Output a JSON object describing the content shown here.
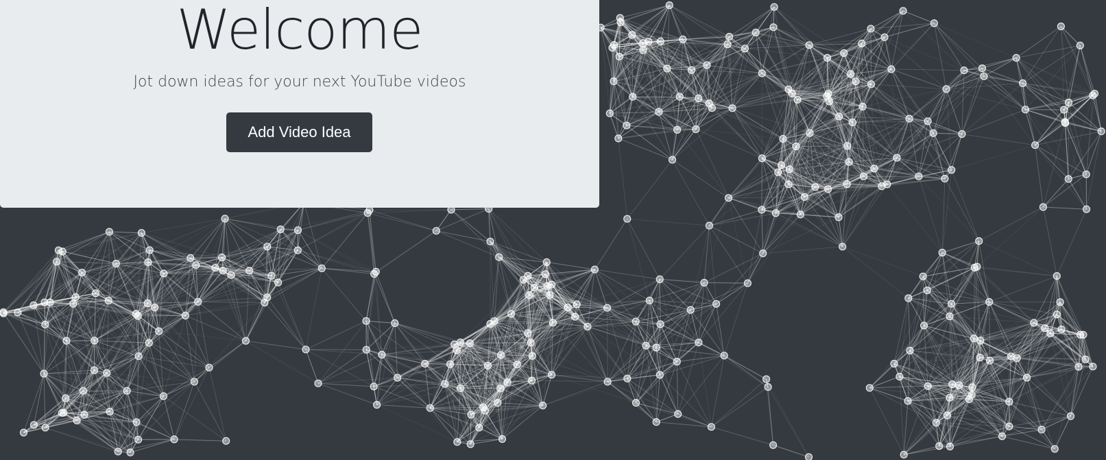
{
  "hero": {
    "title": "Welcome",
    "subtitle": "Jot down ideas for your next YouTube videos",
    "button_label": "Add Video Idea"
  },
  "theme": {
    "background": "#343a40",
    "panel": "#e9ecef",
    "button": "#343a40",
    "particle": "#ffffff"
  },
  "background": {
    "effect": "particle-network"
  }
}
